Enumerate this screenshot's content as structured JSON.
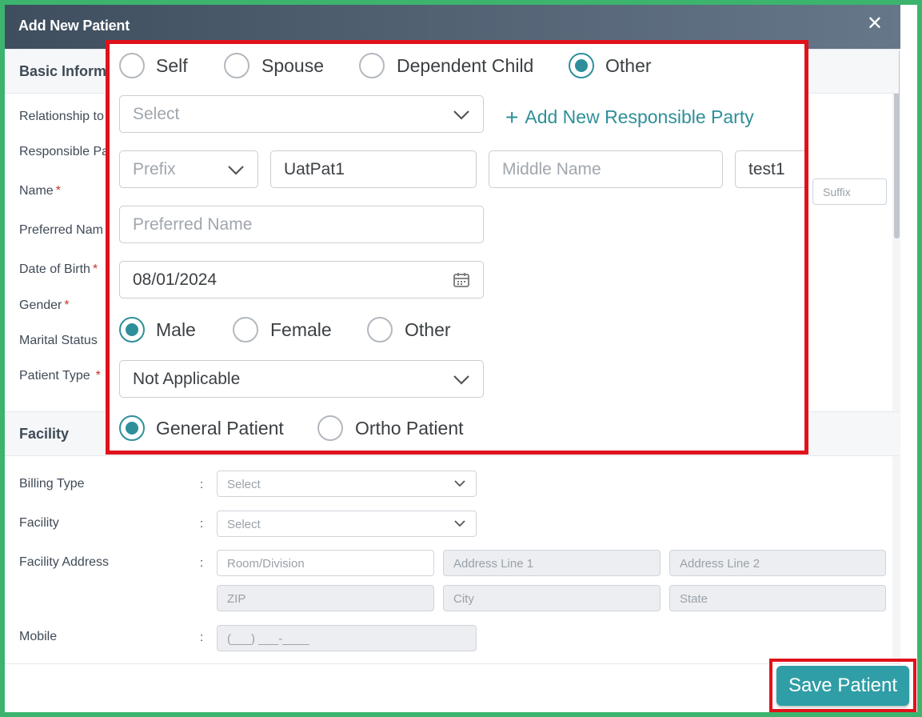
{
  "dialog": {
    "title": "Add New Patient",
    "close_glyph": "✕"
  },
  "basic": {
    "header": "Basic Inform",
    "labels": {
      "relationship": "Relationship to",
      "responsible": "Responsible Pa",
      "name": "Name",
      "preferred": "Preferred Nam",
      "dob": "Date of Birth",
      "gender": "Gender",
      "marital": "Marital Status",
      "patient_type": "Patient Type"
    },
    "required_mark": "*",
    "suffix_placeholder": "Suffix"
  },
  "zoom": {
    "relationship_options": [
      "Self",
      "Spouse",
      "Dependent Child",
      "Other"
    ],
    "relationship_selected": "Other",
    "responsible_placeholder": "Select",
    "add_responsible_label": "Add New Responsible Party",
    "add_responsible_glyph": "+",
    "prefix_placeholder": "Prefix",
    "first_name": "UatPat1",
    "middle_placeholder": "Middle Name",
    "last_name": "test1",
    "preferred_placeholder": "Preferred Name",
    "dob": "08/01/2024",
    "gender_options": [
      "Male",
      "Female",
      "Other"
    ],
    "gender_selected": "Male",
    "marital_status": "Not Applicable",
    "patient_type_options": [
      "General Patient",
      "Ortho Patient"
    ],
    "patient_type_selected": "General Patient"
  },
  "facility": {
    "header": "Facility",
    "colon": ":",
    "billing_label": "Billing Type",
    "billing_placeholder": "Select",
    "facility_label": "Facility",
    "facility_placeholder": "Select",
    "address_label": "Facility Address",
    "room_placeholder": "Room/Division",
    "addr1_placeholder": "Address Line 1",
    "addr2_placeholder": "Address Line 2",
    "zip_placeholder": "ZIP",
    "city_placeholder": "City",
    "state_placeholder": "State",
    "mobile_label": "Mobile",
    "mobile_placeholder": "(___) ___-____"
  },
  "footer": {
    "save_label": "Save Patient"
  },
  "colors": {
    "accent": "#2e8f9a",
    "highlight": "#e0121b",
    "frame": "#3cb46e"
  }
}
